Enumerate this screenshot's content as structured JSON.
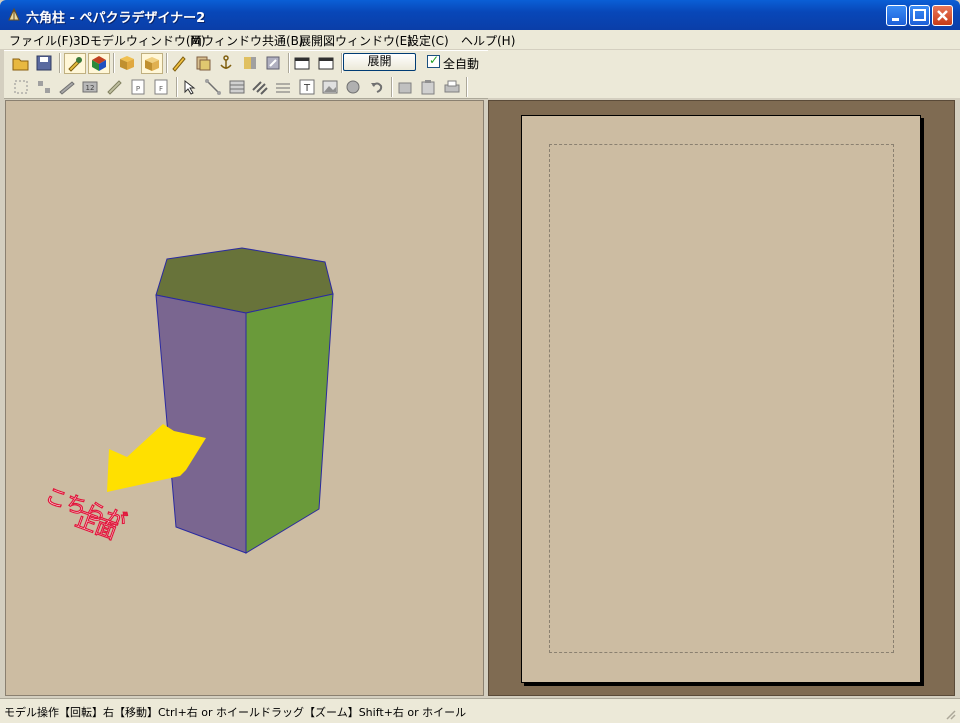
{
  "window": {
    "title": "六角柱 - ペパクラデザイナー2"
  },
  "menu": {
    "items": [
      "ファイル(F)",
      "3Dモデルウィンドウ(M)",
      "両ウィンドウ共通(B)",
      "展開図ウィンドウ(E)",
      "設定(C)",
      "ヘルプ(H)"
    ]
  },
  "toolbar": {
    "unfold_button": "展開",
    "auto_checkbox_label": "全自動",
    "auto_checked": true
  },
  "viewport": {
    "annotation_line1": "こちらが",
    "annotation_line2": "正面",
    "top_face_color": "#68733a",
    "left_face_color": "#7a6690",
    "right_face_color": "#6a9a3a",
    "arrow_color": "#ffe000",
    "annotation_color": "#e0183c"
  },
  "status": {
    "text": "モデル操作【回転】右【移動】Ctrl+右 or ホイールドラッグ【ズーム】Shift+右 or ホイール"
  }
}
